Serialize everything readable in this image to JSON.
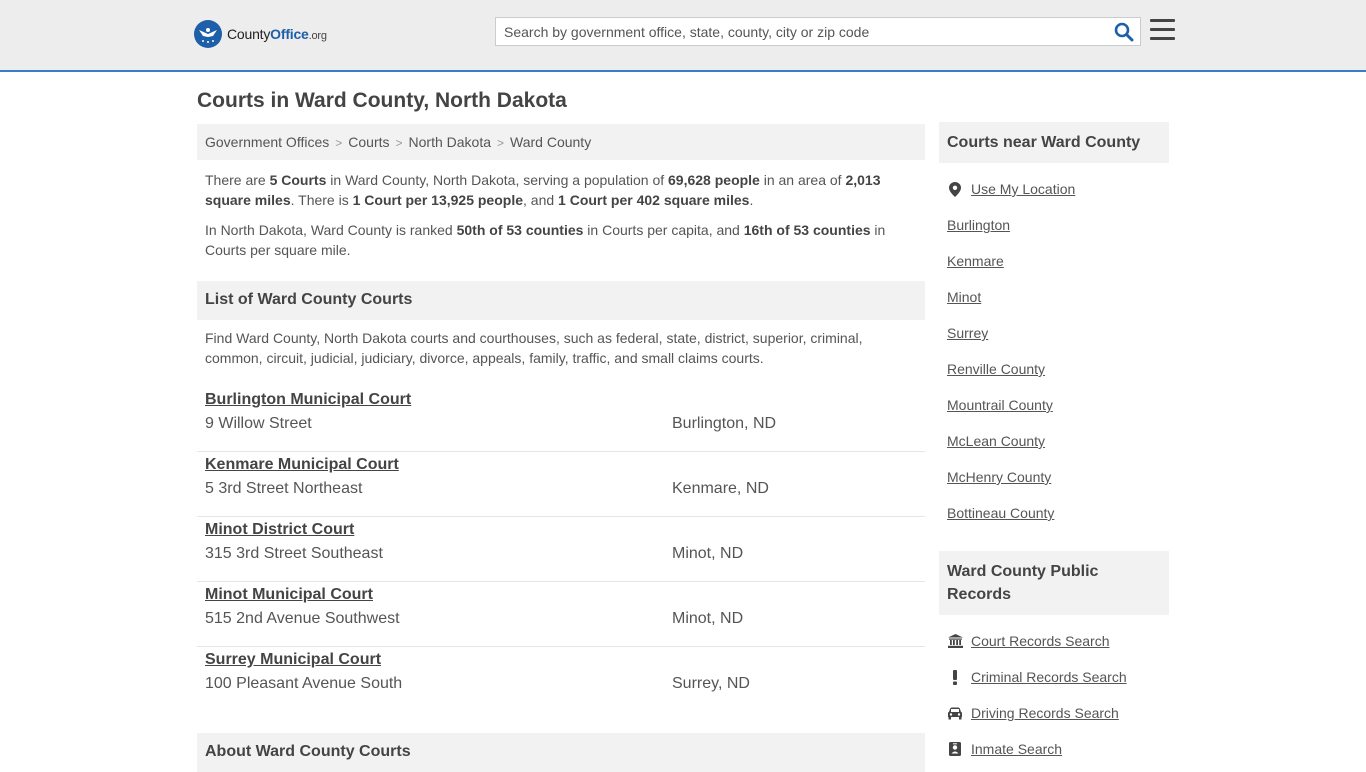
{
  "header": {
    "logo": {
      "brand": "County",
      "brand_bold": "Office",
      "tld": ".org"
    },
    "search_placeholder": "Search by government office, state, county, city or zip code"
  },
  "page_title": "Courts in Ward County, North Dakota",
  "breadcrumb": [
    "Government Offices",
    "Courts",
    "North Dakota",
    "Ward County"
  ],
  "intro": {
    "p1": {
      "t1": "There are ",
      "b1": "5 Courts",
      "t2": " in Ward County, North Dakota, serving a population of ",
      "b2": "69,628 people",
      "t3": " in an area of ",
      "b3": "2,013 square miles",
      "t4": ". There is ",
      "b4": "1 Court per 13,925 people",
      "t5": ", and ",
      "b5": "1 Court per 402 square miles",
      "t6": "."
    },
    "p2": {
      "t1": "In North Dakota, Ward County is ranked ",
      "b1": "50th of 53 counties",
      "t2": " in Courts per capita, and ",
      "b2": "16th of 53 counties",
      "t3": " in Courts per square mile."
    }
  },
  "list_section": {
    "title": "List of Ward County Courts",
    "description": "Find Ward County, North Dakota courts and courthouses, such as federal, state, district, superior, criminal, common, circuit, judicial, judiciary, divorce, appeals, family, traffic, and small claims courts."
  },
  "courts": [
    {
      "name": "Burlington Municipal Court",
      "address": "9 Willow Street",
      "city": "Burlington, ND"
    },
    {
      "name": "Kenmare Municipal Court",
      "address": "5 3rd Street Northeast",
      "city": "Kenmare, ND"
    },
    {
      "name": "Minot District Court",
      "address": "315 3rd Street Southeast",
      "city": "Minot, ND"
    },
    {
      "name": "Minot Municipal Court",
      "address": "515 2nd Avenue Southwest",
      "city": "Minot, ND"
    },
    {
      "name": "Surrey Municipal Court",
      "address": "100 Pleasant Avenue South",
      "city": "Surrey, ND"
    }
  ],
  "about_title": "About Ward County Courts",
  "sidebar": {
    "nearby_title": "Courts near Ward County",
    "use_location": "Use My Location",
    "nearby": [
      "Burlington",
      "Kenmare",
      "Minot",
      "Surrey",
      "Renville County",
      "Mountrail County",
      "McLean County",
      "McHenry County",
      "Bottineau County"
    ],
    "records_title": "Ward County Public Records",
    "records": [
      {
        "label": "Court Records Search",
        "icon": "courthouse-icon"
      },
      {
        "label": "Criminal Records Search",
        "icon": "exclamation-icon"
      },
      {
        "label": "Driving Records Search",
        "icon": "car-icon"
      },
      {
        "label": "Inmate Search",
        "icon": "id-badge-icon"
      }
    ]
  },
  "colors": {
    "accent": "#3b7dc4",
    "logo_blue": "#1d5fa8",
    "text": "#555555",
    "panel": "#f2f2f2"
  }
}
